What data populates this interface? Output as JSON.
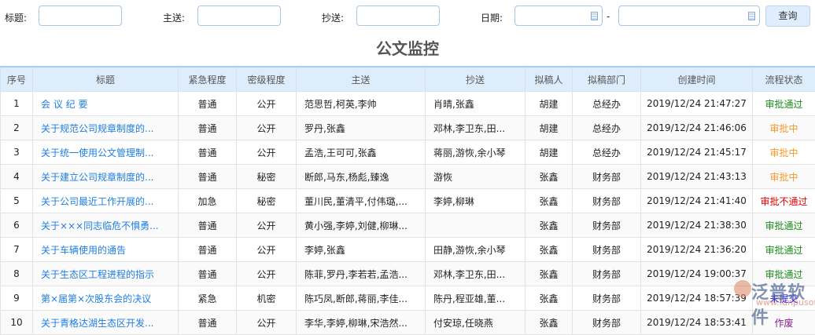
{
  "filters": {
    "title_label": "标题:",
    "to_label": "主送:",
    "cc_label": "抄送:",
    "date_label": "日期:",
    "date_sep": "-",
    "query_label": "查询"
  },
  "page_title": "公文监控",
  "columns": [
    "序号",
    "标题",
    "紧急程度",
    "密级程度",
    "主送",
    "抄送",
    "拟稿人",
    "拟稿部门",
    "创建时间",
    "流程状态"
  ],
  "status_colors": {
    "审批通过": "#1a8a1a",
    "审批中": "#f39a2b",
    "审批不通过": "#e00000",
    "未提交": "#1010ee",
    "作废": "#8a1a8a"
  },
  "rows": [
    {
      "no": "1",
      "title": "会 议 纪 要",
      "urgency": "普通",
      "secret": "公开",
      "to": "范思哲,柯英,李帅",
      "cc": "肖晴,张鑫",
      "drafter": "胡建",
      "dept": "总经办",
      "time": "2019/12/24 21:47:27",
      "status": "审批通过"
    },
    {
      "no": "2",
      "title": "关于规范公司规章制度的...",
      "urgency": "普通",
      "secret": "公开",
      "to": "罗丹,张鑫",
      "cc": "邓林,李卫东,田...",
      "drafter": "胡建",
      "dept": "总经办",
      "time": "2019/12/24 21:46:06",
      "status": "审批中"
    },
    {
      "no": "3",
      "title": "关于统一使用公文管理制...",
      "urgency": "普通",
      "secret": "公开",
      "to": "孟浩,王可可,张鑫",
      "cc": "蒋丽,游恢,余小琴",
      "drafter": "胡建",
      "dept": "总经办",
      "time": "2019/12/24 21:45:17",
      "status": "审批中"
    },
    {
      "no": "4",
      "title": "关于建立公司规章制度的...",
      "urgency": "普通",
      "secret": "秘密",
      "to": "断郎,马东,杨彪,臻逸",
      "cc": "游恢",
      "drafter": "张鑫",
      "dept": "财务部",
      "time": "2019/12/24 21:43:13",
      "status": "审批中"
    },
    {
      "no": "5",
      "title": "关于公司最近工作开展的...",
      "urgency": "加急",
      "secret": "秘密",
      "to": "董川民,董清平,付伟璐,...",
      "cc": "李婷,柳琳",
      "drafter": "张鑫",
      "dept": "财务部",
      "time": "2019/12/24 21:41:40",
      "status": "审批不通过"
    },
    {
      "no": "6",
      "title": "关于×××同志临危不惧勇...",
      "urgency": "普通",
      "secret": "公开",
      "to": "黄小强,李婷,刘健,柳琳...",
      "cc": "",
      "drafter": "张鑫",
      "dept": "财务部",
      "time": "2019/12/24 21:38:30",
      "status": "审批通过"
    },
    {
      "no": "7",
      "title": "关于车辆使用的通告",
      "urgency": "普通",
      "secret": "公开",
      "to": "李婷,张鑫",
      "cc": "田静,游恢,余小琴",
      "drafter": "张鑫",
      "dept": "财务部",
      "time": "2019/12/24 21:36:20",
      "status": "审批通过"
    },
    {
      "no": "8",
      "title": "关于生态区工程进程的指示",
      "urgency": "普通",
      "secret": "公开",
      "to": "陈菲,罗丹,李若若,孟浩...",
      "cc": "邓林,李卫东,田...",
      "drafter": "张鑫",
      "dept": "财务部",
      "time": "2019/12/24 19:00:37",
      "status": "审批通过"
    },
    {
      "no": "9",
      "title": "第×届第×次股东会的决议",
      "urgency": "紧急",
      "secret": "机密",
      "to": "陈巧凤,断郎,蒋丽,李佳...",
      "cc": "陈丹,程亚雄,董...",
      "drafter": "张鑫",
      "dept": "财务部",
      "time": "2019/12/24 18:57:39",
      "status": "未提交"
    },
    {
      "no": "10",
      "title": "关于青格达湖生态区开发...",
      "urgency": "普通",
      "secret": "公开",
      "to": "李华,李婷,柳琳,宋浩然...",
      "cc": "付安琼,任晓燕",
      "drafter": "张鑫",
      "dept": "财务部",
      "time": "2019/12/24 18:53:41",
      "status": "作废"
    }
  ],
  "watermark": {
    "name": "泛普软件",
    "url": "www.fanpusoft.com"
  }
}
